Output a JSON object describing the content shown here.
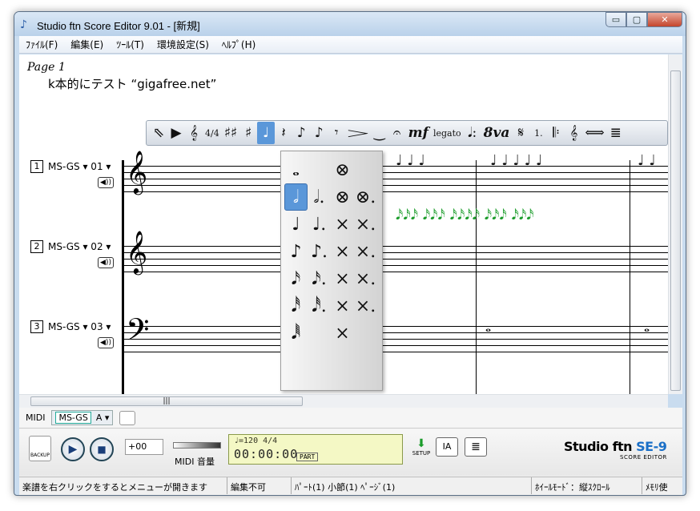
{
  "window": {
    "title": "Studio ftn Score Editor 9.01 - [新規]",
    "controls": {
      "minimize": "▭",
      "maximize": "▢",
      "close": "✕"
    }
  },
  "menu": [
    "ﾌｧｲﾙ(F)",
    "編集(E)",
    "ﾂｰﾙ(T)",
    "環境設定(S)",
    "ﾍﾙﾌﾟ(H)"
  ],
  "score": {
    "page_label": "Page 1",
    "title": "k本的にテスト “gigafree.net”"
  },
  "tracks": [
    {
      "num": "1",
      "name": "MS-GS ▾ 01 ▾",
      "clef": "𝄞"
    },
    {
      "num": "2",
      "name": "MS-GS ▾ 02 ▾",
      "clef": "𝄞"
    },
    {
      "num": "3",
      "name": "MS-GS ▾ 03 ▾",
      "clef": "𝄢"
    }
  ],
  "toolbar_items": [
    "⇖",
    "▶",
    "𝄞",
    "4/4",
    "♯♯",
    "♯",
    "♩",
    "𝄽",
    "♪",
    "♪",
    "𝄾",
    "𝆓",
    "‿",
    "𝄐",
    "mf",
    "legato",
    "𝅘𝅥:",
    "8va",
    "𝄋",
    "1.",
    "𝄆",
    "𝄞",
    "⟺",
    "≣"
  ],
  "toolbar_active_index": 6,
  "palette": [
    [
      "𝅝",
      "",
      "⊗",
      ""
    ],
    [
      "𝅗𝅥",
      "𝅗𝅥.",
      "⊗",
      "⊗."
    ],
    [
      "♩",
      "♩.",
      "×",
      "×."
    ],
    [
      "♪",
      "♪.",
      "×",
      "×."
    ],
    [
      "𝅘𝅥𝅯",
      "𝅘𝅥𝅯.",
      "×",
      "×."
    ],
    [
      "𝅘𝅥𝅰",
      "𝅘𝅥𝅰.",
      "×",
      "×."
    ],
    [
      "𝅘𝅥𝅱",
      "",
      "×",
      ""
    ]
  ],
  "midi": {
    "label": "MIDI",
    "device": "MS-GS",
    "channel": "A ▾"
  },
  "transport": {
    "backup_label": "BACKUP",
    "play": "▶",
    "stop": "■",
    "transpose": "+00",
    "volume_label": "MIDI 音量",
    "volume_level": 0.95,
    "tempo": "♩=120   4/4",
    "time": "00:00:00",
    "part": "PART",
    "setup_label": "SETUP",
    "ia_label": "IA",
    "sheet_icon": "≣"
  },
  "brand": {
    "name": "Studio ftn ",
    "model": "SE-9",
    "sub": "SCORE EDITOR"
  },
  "status": [
    "楽譜を右クリックをするとメニューが開きます",
    "編集不可",
    "ﾊﾟｰﾄ(1) 小節(1) ﾍﾟｰｼﾞ(1)",
    "ﾎｲｰﾙﾓｰﾄﾞ：縦ｽｸﾛｰﾙ",
    "ﾒﾓﾘ使"
  ]
}
